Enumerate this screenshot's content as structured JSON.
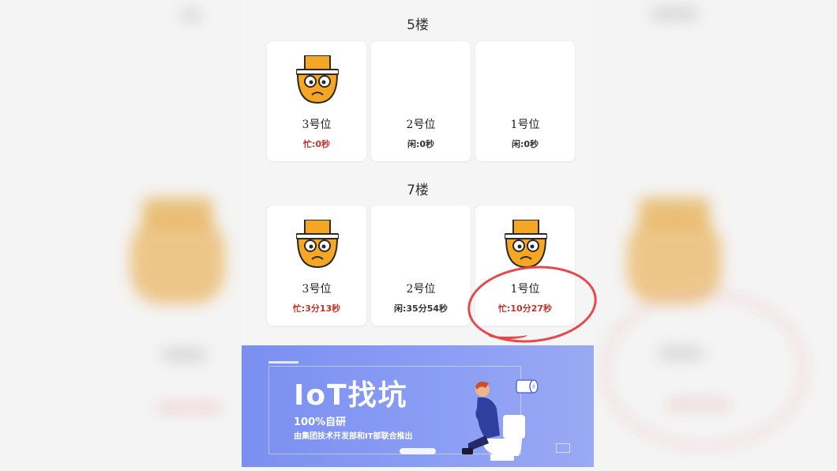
{
  "floors": [
    {
      "title": "5楼",
      "slots": [
        {
          "label": "3号位",
          "status": "忙:0秒",
          "state": "busy"
        },
        {
          "label": "2号位",
          "status": "闲:0秒",
          "state": "idle"
        },
        {
          "label": "1号位",
          "status": "闲:0秒",
          "state": "idle"
        }
      ]
    },
    {
      "title": "7楼",
      "slots": [
        {
          "label": "3号位",
          "status": "忙:3分13秒",
          "state": "busy"
        },
        {
          "label": "2号位",
          "status": "闲:35分54秒",
          "state": "idle"
        },
        {
          "label": "1号位",
          "status": "忙:10分27秒",
          "state": "busy"
        }
      ]
    }
  ],
  "banner": {
    "title": "IoT找坑",
    "subtitle": "100%自研",
    "description": "由集团技术开发部和IT部联合推出"
  },
  "colors": {
    "busy_text": "#c0342c",
    "idle_text": "#333333",
    "toilet_orange": "#f5a623",
    "annotation_red": "#e8474d",
    "banner_blue": "#7a8ff0"
  },
  "icons": {
    "occupied": "toilet-face-icon",
    "person": "person-on-toilet-illustration",
    "paper": "toilet-paper-icon"
  }
}
